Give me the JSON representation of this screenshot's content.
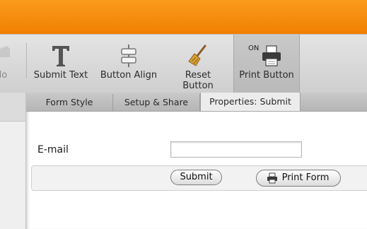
{
  "toolbar": {
    "undo_label": "do",
    "items": [
      {
        "label": "Submit Text",
        "icon": "text-t-icon"
      },
      {
        "label": "Button Align",
        "icon": "align-icon"
      },
      {
        "label": "Reset\nButton",
        "icon": "broom-icon"
      },
      {
        "label": "Print Button",
        "icon": "printer-icon",
        "badge": "ON"
      }
    ]
  },
  "tabs": [
    {
      "label": "Form Style"
    },
    {
      "label": "Setup & Share"
    },
    {
      "label": "Properties: Submit",
      "active": true
    }
  ],
  "form": {
    "email_label": "E-mail",
    "email_value": "",
    "submit_label": "Submit",
    "print_label": "Print Form"
  },
  "colors": {
    "accent": "#f7901e",
    "toolbar": "#d9d9d9",
    "active_tab": "#ececec"
  }
}
